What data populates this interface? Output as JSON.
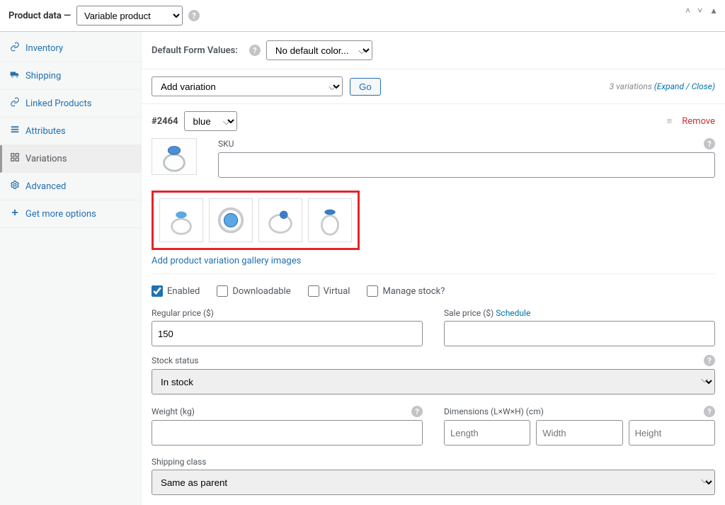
{
  "header": {
    "title_prefix": "Product data —",
    "product_type": "Variable product"
  },
  "sidebar": {
    "items": [
      {
        "label": "Inventory"
      },
      {
        "label": "Shipping"
      },
      {
        "label": "Linked Products"
      },
      {
        "label": "Attributes"
      },
      {
        "label": "Variations"
      },
      {
        "label": "Advanced"
      },
      {
        "label": "Get more options"
      }
    ]
  },
  "toprow": {
    "label": "Default Form Values:",
    "default_value": "No default color..."
  },
  "add_row": {
    "select": "Add variation",
    "go": "Go",
    "count_text": "3 variations",
    "expand_close": "(Expand / Close)"
  },
  "variation": {
    "id": "#2464",
    "attr": "blue",
    "remove": "Remove",
    "add_gallery": "Add product variation gallery images"
  },
  "checks": {
    "enabled": "Enabled",
    "downloadable": "Downloadable",
    "virtual": "Virtual",
    "manage_stock": "Manage stock?"
  },
  "fields": {
    "sku": "SKU",
    "regular_price": "Regular price ($)",
    "regular_price_val": "150",
    "sale_price": "Sale price ($)",
    "schedule": "Schedule",
    "stock_status": "Stock status",
    "in_stock": "In stock",
    "weight": "Weight (kg)",
    "dimensions": "Dimensions (L×W×H) (cm)",
    "length_ph": "Length",
    "width_ph": "Width",
    "height_ph": "Height",
    "shipping_class": "Shipping class",
    "same_as_parent": "Same as parent"
  }
}
